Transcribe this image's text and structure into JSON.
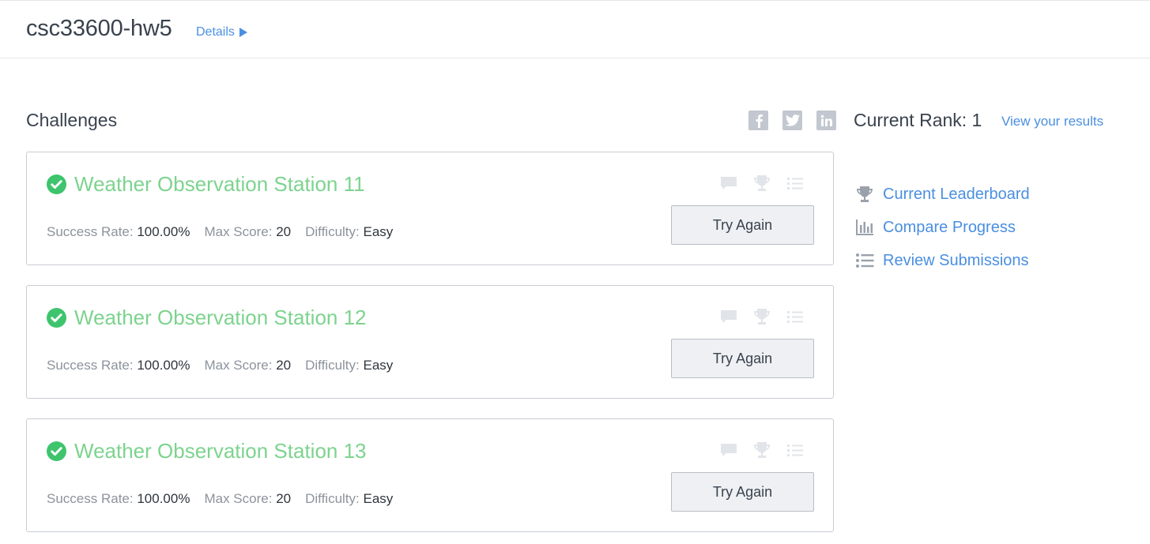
{
  "header": {
    "title": "csc33600-hw5",
    "details_label": "Details"
  },
  "challenges_section": {
    "title": "Challenges"
  },
  "social": [
    "facebook-icon",
    "twitter-icon",
    "linkedin-icon"
  ],
  "rank": {
    "text": "Current Rank: 1",
    "view_results_label": "View your results"
  },
  "challenges": [
    {
      "name": "Weather Observation Station 11",
      "success_rate_label": "Success Rate:",
      "success_rate": "100.00%",
      "max_score_label": "Max Score:",
      "max_score": "20",
      "difficulty_label": "Difficulty:",
      "difficulty": "Easy",
      "button_label": "Try Again"
    },
    {
      "name": "Weather Observation Station 12",
      "success_rate_label": "Success Rate:",
      "success_rate": "100.00%",
      "max_score_label": "Max Score:",
      "max_score": "20",
      "difficulty_label": "Difficulty:",
      "difficulty": "Easy",
      "button_label": "Try Again"
    },
    {
      "name": "Weather Observation Station 13",
      "success_rate_label": "Success Rate:",
      "success_rate": "100.00%",
      "max_score_label": "Max Score:",
      "max_score": "20",
      "difficulty_label": "Difficulty:",
      "difficulty": "Easy",
      "button_label": "Try Again"
    }
  ],
  "sidebar": {
    "links": [
      {
        "label": "Current Leaderboard",
        "icon": "trophy-icon"
      },
      {
        "label": "Compare Progress",
        "icon": "bar-chart-icon"
      },
      {
        "label": "Review Submissions",
        "icon": "list-icon"
      }
    ]
  },
  "colors": {
    "accent_link": "#4a8fe0",
    "solved_green": "#7dd38e",
    "check_green": "#3ec46d",
    "icon_gray": "#c2c7d0",
    "text_dark": "#39424e"
  }
}
